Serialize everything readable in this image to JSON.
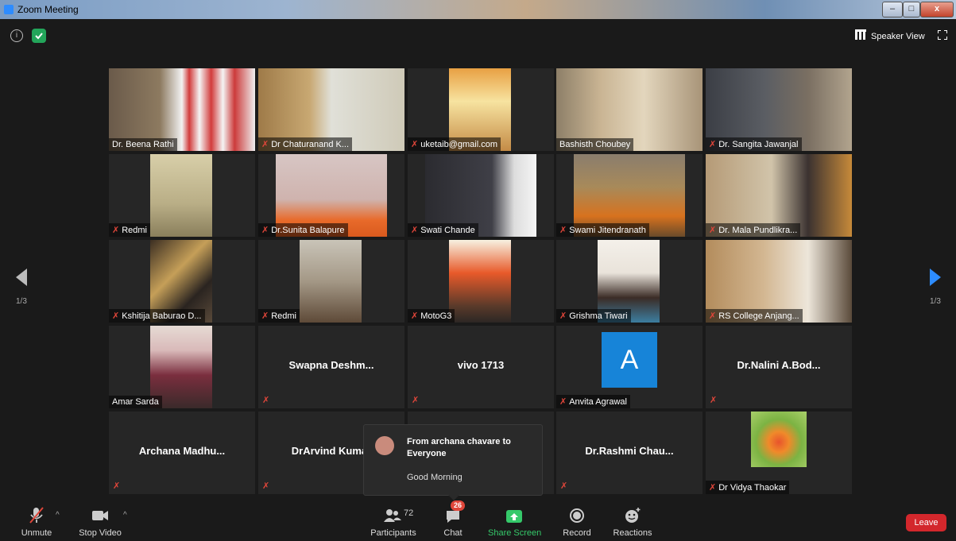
{
  "window": {
    "title": "Zoom Meeting",
    "min": "–",
    "max": "□",
    "close": "x"
  },
  "topbar": {
    "info_glyph": "i",
    "view_label": "Speaker View"
  },
  "nav": {
    "page": "1/3"
  },
  "participants_grid": [
    {
      "name": "Dr. Beena Rathi",
      "muted": false,
      "video": true
    },
    {
      "name": "Dr Chaturanand K...",
      "muted": true,
      "video": true
    },
    {
      "name": "uketaib@gmail.com",
      "muted": true,
      "video": true
    },
    {
      "name": "Bashisth Choubey",
      "muted": false,
      "video": true,
      "active_speaker": true
    },
    {
      "name": "Dr. Sangita Jawanjal",
      "muted": true,
      "video": true
    },
    {
      "name": "Redmi",
      "muted": true,
      "video": true
    },
    {
      "name": "Dr.Sunita Balapure",
      "muted": true,
      "video": true
    },
    {
      "name": "Swati Chande",
      "muted": true,
      "video": true
    },
    {
      "name": "Swami Jitendranath",
      "muted": true,
      "video": true
    },
    {
      "name": "Dr. Mala Pundlikra...",
      "muted": true,
      "video": true
    },
    {
      "name": "Kshitija Baburao D...",
      "muted": true,
      "video": true
    },
    {
      "name": "Redmi",
      "muted": true,
      "video": true
    },
    {
      "name": "MotoG3",
      "muted": true,
      "video": true
    },
    {
      "name": "Grishma Tiwari",
      "muted": true,
      "video": true
    },
    {
      "name": "RS College Anjang...",
      "muted": true,
      "video": true
    },
    {
      "name": "Amar Sarda",
      "muted": false,
      "video": true
    },
    {
      "name": "Swapna Deshm...",
      "muted": true,
      "video": false
    },
    {
      "name": "vivo 1713",
      "muted": true,
      "video": false
    },
    {
      "name": "Anvita Agrawal",
      "muted": true,
      "video": false,
      "avatar_letter": "A"
    },
    {
      "name": "Dr.Nalini A.Bod...",
      "muted": true,
      "video": false
    },
    {
      "name": "Archana Madhu...",
      "muted": true,
      "video": false
    },
    {
      "name": "DrArvind Kumar",
      "muted": true,
      "video": false
    },
    {
      "name": "",
      "muted": false,
      "video": false
    },
    {
      "name": "Dr.Rashmi Chau...",
      "muted": true,
      "video": false
    },
    {
      "name": "Dr Vidya Thaokar",
      "muted": true,
      "video": true
    }
  ],
  "chat_popup": {
    "from": "From archana chavare to Everyone",
    "message": "Good Morning"
  },
  "toolbar": {
    "unmute": "Unmute",
    "stop_video": "Stop Video",
    "participants": "Participants",
    "participants_count": "72",
    "chat": "Chat",
    "chat_badge": "26",
    "share_screen": "Share Screen",
    "record": "Record",
    "reactions": "Reactions",
    "leave": "Leave"
  },
  "colors": {
    "active_speaker": "#c8e64a",
    "share": "#35c96a",
    "leave": "#d3272c",
    "muted_mic": "#e0463a"
  }
}
